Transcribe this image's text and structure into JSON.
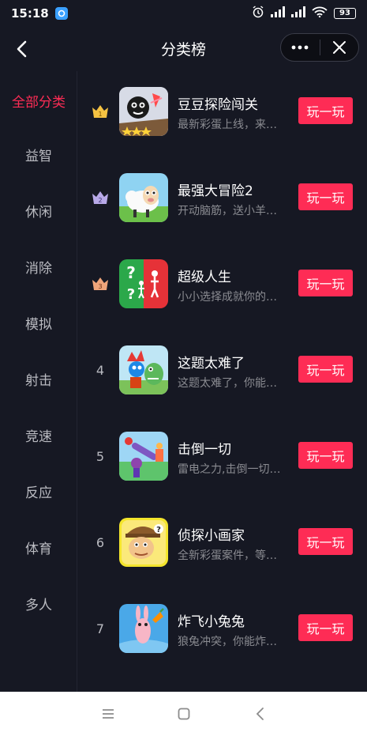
{
  "status": {
    "time": "15:18",
    "battery": "93"
  },
  "header": {
    "title": "分类榜"
  },
  "sidebar": {
    "items": [
      {
        "label": "全部分类",
        "active": true
      },
      {
        "label": "益智"
      },
      {
        "label": "休闲"
      },
      {
        "label": "消除"
      },
      {
        "label": "模拟"
      },
      {
        "label": "射击"
      },
      {
        "label": "竞速"
      },
      {
        "label": "反应"
      },
      {
        "label": "体育"
      },
      {
        "label": "多人"
      }
    ]
  },
  "colors": {
    "accent": "#fe2c55",
    "background": "#161823",
    "gold": "#f5c242",
    "silver": "#b8a9e8",
    "bronze": "#f0a57a"
  },
  "games": [
    {
      "rank": "1",
      "name": "豆豆探险闯关",
      "desc": "最新彩蛋上线，来一起探险吧",
      "play": "玩一玩"
    },
    {
      "rank": "2",
      "name": "最强大冒险2",
      "desc": "开动脑筋，送小羊回家",
      "play": "玩一玩"
    },
    {
      "rank": "3",
      "name": "超级人生",
      "desc": "小小选择成就你的人生",
      "play": "玩一玩"
    },
    {
      "rank": "4",
      "name": "这题太难了",
      "desc": "这题太难了，你能通关吗",
      "play": "玩一玩"
    },
    {
      "rank": "5",
      "name": "击倒一切",
      "desc": "雷电之力,击倒一切敌人",
      "play": "玩一玩"
    },
    {
      "rank": "6",
      "name": "侦探小画家",
      "desc": "全新彩蛋案件，等你来破解",
      "play": "玩一玩"
    },
    {
      "rank": "7",
      "name": "炸飞小兔兔",
      "desc": "狼兔冲突，你能炸飞它吗",
      "play": "玩一玩"
    }
  ]
}
